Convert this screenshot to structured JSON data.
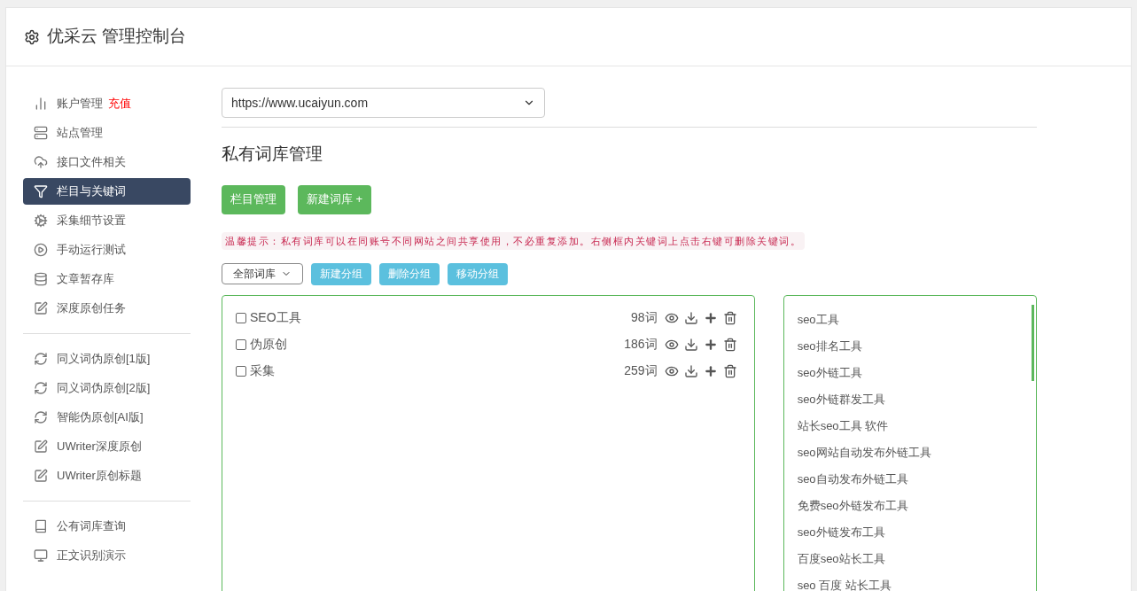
{
  "header": {
    "title": "优采云 管理控制台"
  },
  "sidebar": {
    "groups": [
      [
        {
          "label": "账户管理",
          "badge": "充值",
          "selected": false
        },
        {
          "label": "站点管理",
          "selected": false
        },
        {
          "label": "接口文件相关",
          "selected": false
        },
        {
          "label": "栏目与关键词",
          "selected": true
        },
        {
          "label": "采集细节设置",
          "selected": false
        },
        {
          "label": "手动运行测试",
          "selected": false
        },
        {
          "label": "文章暂存库",
          "selected": false
        },
        {
          "label": "深度原创任务",
          "selected": false
        }
      ],
      [
        {
          "label": "同义词伪原创[1版]",
          "selected": false
        },
        {
          "label": "同义词伪原创[2版]",
          "selected": false
        },
        {
          "label": "智能伪原创[AI版]",
          "selected": false
        },
        {
          "label": "UWriter深度原创",
          "selected": false
        },
        {
          "label": "UWriter原创标题",
          "selected": false
        }
      ],
      [
        {
          "label": "公有词库查询",
          "selected": false
        },
        {
          "label": "正文识别演示",
          "selected": false
        }
      ]
    ]
  },
  "site_select": {
    "value": "https://www.ucaiyun.com"
  },
  "section_title": "私有词库管理",
  "top_buttons": [
    "栏目管理",
    "新建词库 +"
  ],
  "notice": "温馨提示：私有词库可以在同账号不同网站之间共享使用，不必重复添加。右侧框内关键词上点击右键可删除关键词。",
  "group_select": {
    "value": "全部词库"
  },
  "group_buttons": [
    "新建分组",
    "删除分组",
    "移动分组"
  ],
  "libraries": [
    {
      "name": "SEO工具",
      "count": "98词",
      "checked": false
    },
    {
      "name": "伪原创",
      "count": "186词",
      "checked": false
    },
    {
      "name": "采集",
      "count": "259词",
      "checked": false
    }
  ],
  "keywords": [
    "seo工具",
    "seo排名工具",
    "seo外链工具",
    "seo外链群发工具",
    "站长seo工具 软件",
    "seo网站自动发布外链工具",
    "seo自动发布外链工具",
    "免费seo外链发布工具",
    "seo外链发布工具",
    "百度seo站长工具",
    "seo 百度 站长工具"
  ]
}
